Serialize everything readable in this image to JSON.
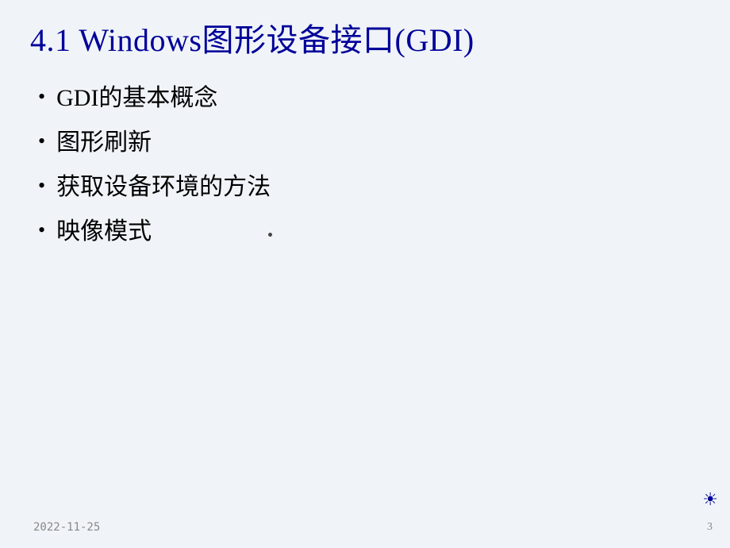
{
  "title": "4.1 Windows图形设备接口(GDI)",
  "bullets": {
    "item0": "GDI的基本概念",
    "item1": "图形刷新",
    "item2": "获取设备环境的方法",
    "item3": "映像模式"
  },
  "footer": {
    "date": "2022-11-25",
    "page": "3"
  }
}
